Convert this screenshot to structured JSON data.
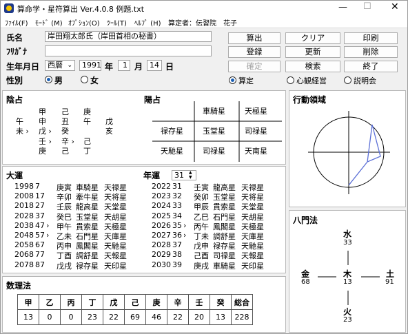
{
  "window": {
    "title": "算命学・星符算出  Ver.4.0.8   例題.txt"
  },
  "menu": [
    "ﾌｧｲﾙ(F)",
    "ﾓｰﾄﾞ (M)",
    "ｵﾌﾟｼｮﾝ(O)",
    "ﾂｰﾙ(T)",
    "ﾍﾙﾌﾟ (H)"
  ],
  "operator": "算定者：伝習院　花子",
  "form": {
    "name_label": "氏名",
    "name_value": "岸田翔太郎氏（岸田首相の秘書）",
    "kana_label": "ﾌﾘｶﾞﾅ",
    "kana_value": "",
    "birth_label": "生年月日",
    "era": "西暦",
    "year": "1991",
    "year_unit": "年",
    "month": "1",
    "month_unit": "月",
    "day": "14",
    "day_unit": "日",
    "sex_label": "性別",
    "male": "男",
    "female": "女"
  },
  "buttons": {
    "calc": "算出",
    "clear": "クリア",
    "print": "印刷",
    "register": "登録",
    "update": "更新",
    "delete": "削除",
    "confirm": "確定",
    "search": "検索",
    "exit": "終了"
  },
  "modes": [
    "算定",
    "心観経営",
    "説明会"
  ],
  "inzen": {
    "title": "陰占",
    "cells": [
      [
        "",
        "甲",
        "己",
        "庚",
        ""
      ],
      [
        "午",
        "申",
        "丑",
        "午",
        "戊"
      ],
      [
        "未 ›",
        "戊 ›",
        "癸",
        "",
        "亥"
      ],
      [
        "",
        "壬 ›",
        "辛 ›",
        "己",
        ""
      ],
      [
        "",
        "庚",
        "己",
        "丁",
        ""
      ]
    ]
  },
  "yozen": {
    "title": "陽占",
    "top": [
      "",
      "車騎星",
      "天極星"
    ],
    "mid": [
      "禄存星",
      "玉堂星",
      "司禄星"
    ],
    "bot": [
      "天馳星",
      "司禄星",
      "天南星"
    ]
  },
  "koudou": {
    "title": "行動領域"
  },
  "taiun": {
    "title": "大運",
    "rows": [
      [
        "1998",
        "7",
        "",
        "庚寅",
        "車騎星",
        "天禄星"
      ],
      [
        "2008",
        "17",
        "",
        "辛卯",
        "牽牛星",
        "天将星"
      ],
      [
        "2018",
        "27",
        "",
        "壬辰",
        "龍高星",
        "天堂星"
      ],
      [
        "2028",
        "37",
        "",
        "癸巳",
        "玉堂星",
        "天胡星"
      ],
      [
        "2038",
        "47",
        "›",
        "甲午",
        "貫索星",
        "天極星"
      ],
      [
        "2048",
        "57",
        "›",
        "乙未",
        "石門星",
        "天庫星"
      ],
      [
        "2058",
        "67",
        "",
        "丙申",
        "鳳閣星",
        "天馳星"
      ],
      [
        "2068",
        "77",
        "",
        "丁酉",
        "調舒星",
        "天報星"
      ],
      [
        "2078",
        "87",
        "",
        "戊戌",
        "禄存星",
        "天印星"
      ]
    ]
  },
  "nenun": {
    "title": "年運",
    "count": "31",
    "rows": [
      [
        "2022",
        "31",
        "",
        "壬寅",
        "龍高星",
        "天禄星"
      ],
      [
        "2023",
        "32",
        "",
        "癸卯",
        "玉堂星",
        "天将星"
      ],
      [
        "2024",
        "33",
        "",
        "甲辰",
        "貫索星",
        "天堂星"
      ],
      [
        "2025",
        "34",
        "",
        "乙巳",
        "石門星",
        "天胡星"
      ],
      [
        "2026",
        "35",
        "›",
        "丙午",
        "鳳閣星",
        "天極星"
      ],
      [
        "2027",
        "36",
        "›",
        "丁未",
        "調舒星",
        "天庫星"
      ],
      [
        "2028",
        "37",
        "",
        "戊申",
        "禄存星",
        "天馳星"
      ],
      [
        "2029",
        "38",
        "",
        "己酉",
        "司禄星",
        "天報星"
      ],
      [
        "2030",
        "39",
        "",
        "庚戌",
        "車騎星",
        "天印星"
      ]
    ]
  },
  "suuri": {
    "title": "数理法",
    "headers": [
      "甲",
      "乙",
      "丙",
      "丁",
      "戊",
      "己",
      "庚",
      "辛",
      "壬",
      "癸",
      "総合"
    ],
    "values": [
      "13",
      "0",
      "0",
      "23",
      "22",
      "69",
      "46",
      "22",
      "20",
      "13",
      "228"
    ]
  },
  "hachimon": {
    "title": "八門法",
    "north": {
      "label": "水",
      "value": "33"
    },
    "west": {
      "label": "金",
      "value": "68"
    },
    "center": {
      "label": "木",
      "value": "13"
    },
    "east": {
      "label": "土",
      "value": "91"
    },
    "south": {
      "label": "火",
      "value": "23"
    }
  }
}
